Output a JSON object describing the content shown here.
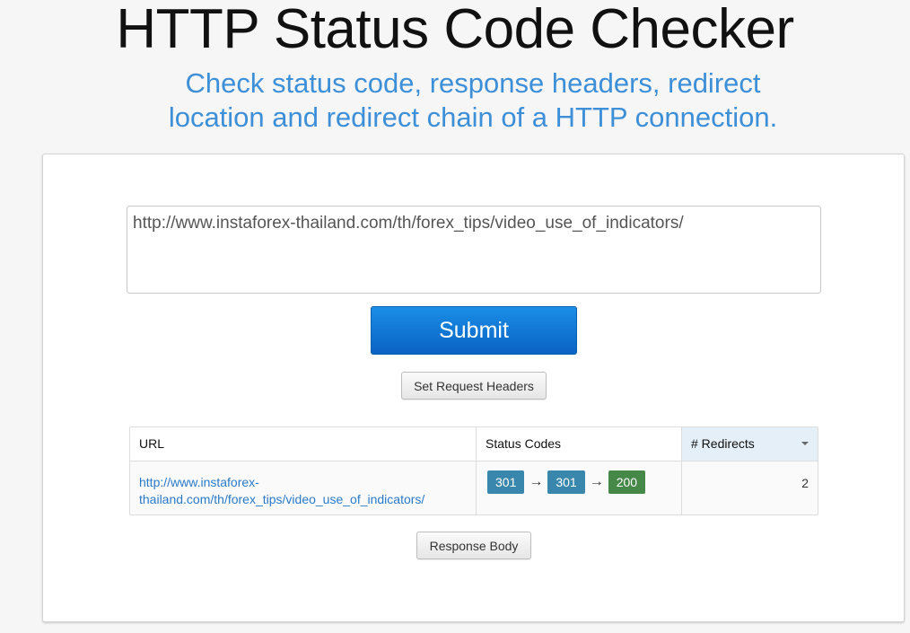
{
  "header": {
    "title": "HTTP Status Code Checker",
    "subtitle": "Check status code, response headers, redirect location and redirect chain of a HTTP connection."
  },
  "form": {
    "url_value": "http://www.instaforex-thailand.com/th/forex_tips/video_use_of_indicators/",
    "submit_label": "Submit",
    "set_headers_label": "Set Request Headers"
  },
  "results": {
    "columns": {
      "url": "URL",
      "status_codes": "Status Codes",
      "redirects": "# Redirects"
    },
    "rows": [
      {
        "url": "http://www.instaforex-thailand.com/th/forex_tips/video_use_of_indicators/",
        "status_chain": [
          {
            "code": "301",
            "color": "#3a87ad"
          },
          {
            "code": "301",
            "color": "#3a87ad"
          },
          {
            "code": "200",
            "color": "#468847"
          }
        ],
        "arrow": "→",
        "redirects": "2"
      }
    ]
  },
  "response_body_label": "Response Body",
  "colors": {
    "subtitle": "#3d8fd8",
    "submit": "#0a72d6",
    "link": "#2a7ac7",
    "redirect_badge": "#3a87ad",
    "ok_badge": "#468847"
  }
}
